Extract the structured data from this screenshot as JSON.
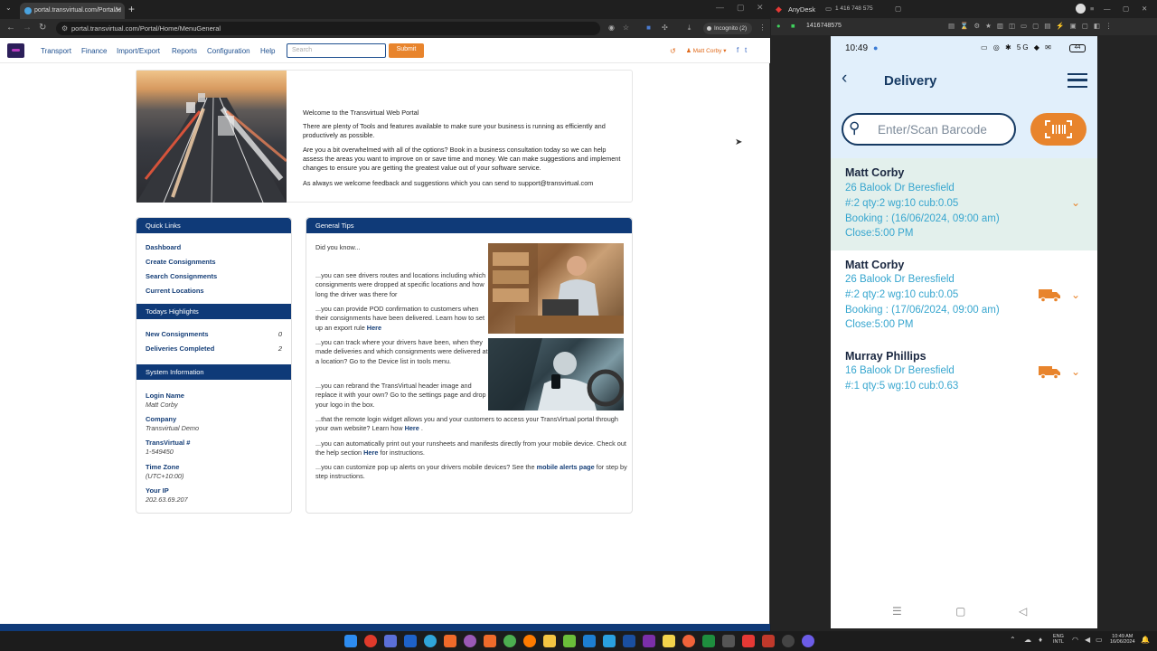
{
  "browser": {
    "tab_title": "portal.transvirtual.com/Portal/H",
    "url": "portal.transvirtual.com/Portal/Home/MenuGeneral",
    "incognito_label": "Incognito (2)"
  },
  "portal_nav": {
    "items": [
      "Transport",
      "Finance",
      "Import/Export",
      "Reports",
      "Configuration",
      "Help"
    ],
    "search_placeholder": "Search",
    "submit_label": "Submit",
    "user_label": "Matt Corby"
  },
  "welcome": {
    "title": "Welcome to the Transvirtual Web Portal",
    "p1": "There are plenty of Tools and features available to make sure your business is running as efficiently and productively as possible.",
    "p2": "Are you a bit overwhelmed with all of the options? Book in a business consultation today so we can help assess the areas you want to improve on or save time and money. We can make suggestions and implement changes to ensure you are getting the greatest value out of your software service.",
    "p3": "As always we welcome feedback and suggestions which you can send to support@transvirtual.com"
  },
  "quick_links": {
    "title": "Quick Links",
    "items": [
      "Dashboard",
      "Create Consignments",
      "Search Consignments",
      "Current Locations"
    ]
  },
  "highlights": {
    "title": "Todays Highlights",
    "rows": [
      {
        "label": "New Consignments",
        "value": "0"
      },
      {
        "label": "Deliveries Completed",
        "value": "2"
      }
    ]
  },
  "system_info": {
    "title": "System Information",
    "rows": [
      {
        "label": "Login Name",
        "value": "Matt Corby"
      },
      {
        "label": "Company",
        "value": "Transvirtual Demo"
      },
      {
        "label": "TransVirtual #",
        "value": "1-549450"
      },
      {
        "label": "Time Zone",
        "value": "(UTC+10:00)"
      },
      {
        "label": "Your IP",
        "value": "202.63.69.207"
      }
    ]
  },
  "general_tips": {
    "title": "General Tips",
    "intro": "Did you know...",
    "t1": "...you can see drivers routes and locations including which consignments were dropped at specific locations and how long the driver was there for",
    "t2a": "...you can provide POD confirmation to customers when their consignments have been delivered. Learn how to set up an export rule ",
    "t2link": "Here",
    "t3": "...you can track where your drivers have been, when they made deliveries and which consignments were delivered at a location? Go to the Device list in tools menu.",
    "t4": "...you can rebrand the TransVirtual header image and replace it with your own? Go to the settings page and drop your logo in the box.",
    "t5a": "...that the remote login widget allows you and your customers to access your TransVirtual portal through your own website? Learn how ",
    "t5link": "Here",
    "t5b": " .",
    "t6a": "...you can automatically print out your runsheets and manifests directly from your mobile device. Check out the help section ",
    "t6link": "Here",
    "t6b": " for instructions.",
    "t7a": "...you can customize pop up alerts on your drivers mobile devices? See the ",
    "t7link": "mobile alerts page",
    "t7b": " for step by step instructions."
  },
  "anydesk": {
    "app_name": "AnyDesk",
    "session_id": "1 416 748 575",
    "address": "1416748575"
  },
  "phone": {
    "time": "10:49",
    "battery": "44",
    "title": "Delivery",
    "barcode_placeholder": "Enter/Scan Barcode",
    "deliveries": [
      {
        "name": "Matt Corby",
        "address": "26 Balook Dr Beresfield",
        "details": "#:2 qty:2 wg:10 cub:0.05",
        "booking": "Booking : (16/06/2024, 09:00 am)",
        "close": "Close:5:00 PM"
      },
      {
        "name": "Matt Corby",
        "address": "26 Balook Dr Beresfield",
        "details": "#:2 qty:2 wg:10 cub:0.05",
        "booking": "Booking : (17/06/2024, 09:00 am)",
        "close": "Close:5:00 PM"
      },
      {
        "name": "Murray Phillips",
        "address": "16 Balook Dr Beresfield",
        "details": "#:1 qty:5 wg:10 cub:0.63"
      }
    ]
  },
  "taskbar": {
    "lang1": "ENG",
    "lang2": "INTL",
    "time": "10:49 AM",
    "date": "16/06/2024"
  },
  "colors": {
    "portal_blue": "#0f3a78",
    "accent_orange": "#e8842c",
    "phone_bg": "#e1effb",
    "phone_text_blue": "#37a6cf"
  }
}
